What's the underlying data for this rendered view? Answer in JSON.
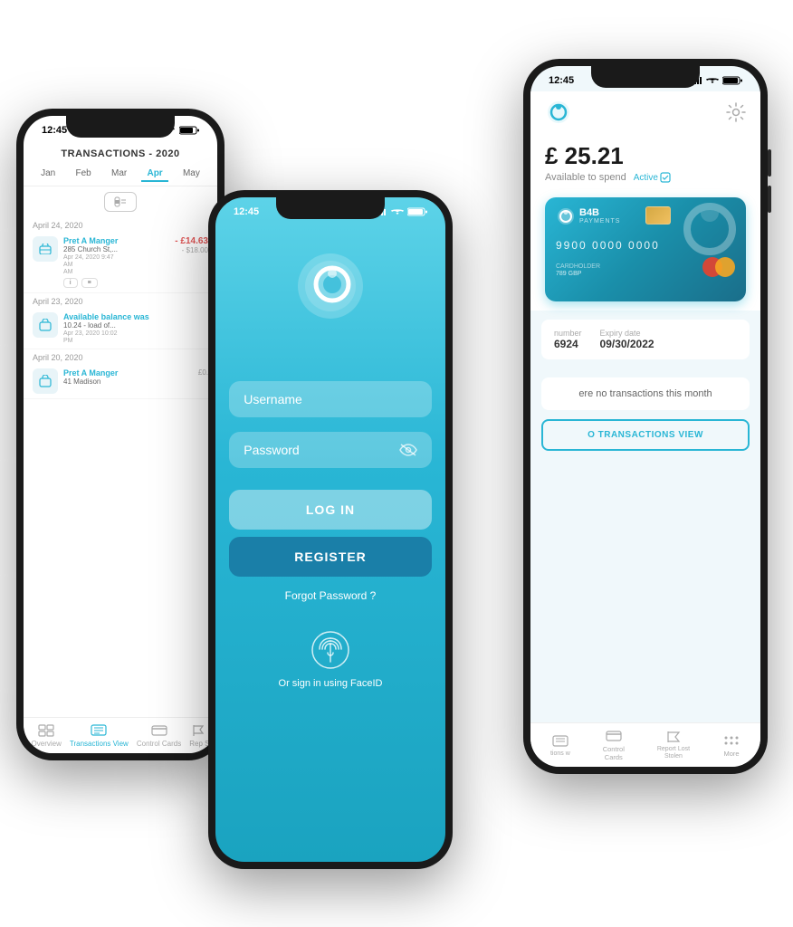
{
  "phones": {
    "left": {
      "statusBar": {
        "time": "12:45",
        "icons": "signal wifi battery"
      },
      "header": "TRANSACTIONS - 2020",
      "months": [
        "Jan",
        "Feb",
        "Mar",
        "Apr",
        "May"
      ],
      "activeMonth": "Apr",
      "transactions": [
        {
          "date": "April 24, 2020",
          "items": [
            {
              "icon": "briefcase",
              "name": "Pret A Manger",
              "address": "285 Church St,...",
              "datetime": "Apr 24, 2020 9:47",
              "amtGbp": "- £14.63",
              "amtUsd": "- $18.00",
              "amLine2": "AM",
              "amLine3": "AM"
            }
          ]
        },
        {
          "date": "April 23, 2020",
          "items": [
            {
              "icon": "bag",
              "name": "Available balance was 10.24 - load of...",
              "address": "",
              "datetime": "Apr 23, 2020 10:02",
              "amtGbp": "",
              "amtUsd": "",
              "amLine2": "PM",
              "amLine3": ""
            }
          ]
        },
        {
          "date": "April 20, 2020",
          "items": [
            {
              "icon": "bag",
              "name": "Pret A Manger",
              "address": "41 Madison",
              "datetime": "",
              "amtGbp": "",
              "amtUsd": "£0.",
              "amLine2": "",
              "amLine3": ""
            }
          ]
        }
      ],
      "nav": [
        {
          "label": "Overview",
          "icon": "grid",
          "active": false
        },
        {
          "label": "Transactions View",
          "icon": "list",
          "active": true
        },
        {
          "label": "Control Cards",
          "icon": "card",
          "active": false
        },
        {
          "label": "Rep S",
          "icon": "flag",
          "active": false
        }
      ]
    },
    "center": {
      "statusBar": {
        "time": "12:45",
        "icons": "signal wifi battery"
      },
      "username_label": "Username",
      "password_label": "Password",
      "login_btn": "LOG IN",
      "register_btn": "REGISTER",
      "forgot_password": "Forgot Password ?",
      "faceid_label": "Or sign in using FaceID"
    },
    "right": {
      "statusBar": {
        "time": "12:45",
        "icons": "signal wifi battery"
      },
      "balance": "£ 25.21",
      "balance_label": "Available to spend",
      "status": "Active",
      "card": {
        "brand": "B4B",
        "brand_sub": "PAYMENTS",
        "number": "9900 0000 0000",
        "holder": "CARDHOLDER",
        "currency": "789 GBP",
        "expiry_label": "Expiry date",
        "expiry": "09/30/2022",
        "sort_label": "number",
        "sort": "6924"
      },
      "no_tx_text": "ere no transactions this month",
      "view_tx_btn": "O TRANSACTIONS VIEW",
      "nav": [
        {
          "label": "tions w",
          "icon": "list",
          "active": false
        },
        {
          "label": "Control Cards",
          "icon": "card",
          "active": false
        },
        {
          "label": "Report Lost Stolen",
          "icon": "flag",
          "active": false
        },
        {
          "label": "More",
          "icon": "dots",
          "active": false
        }
      ]
    }
  }
}
